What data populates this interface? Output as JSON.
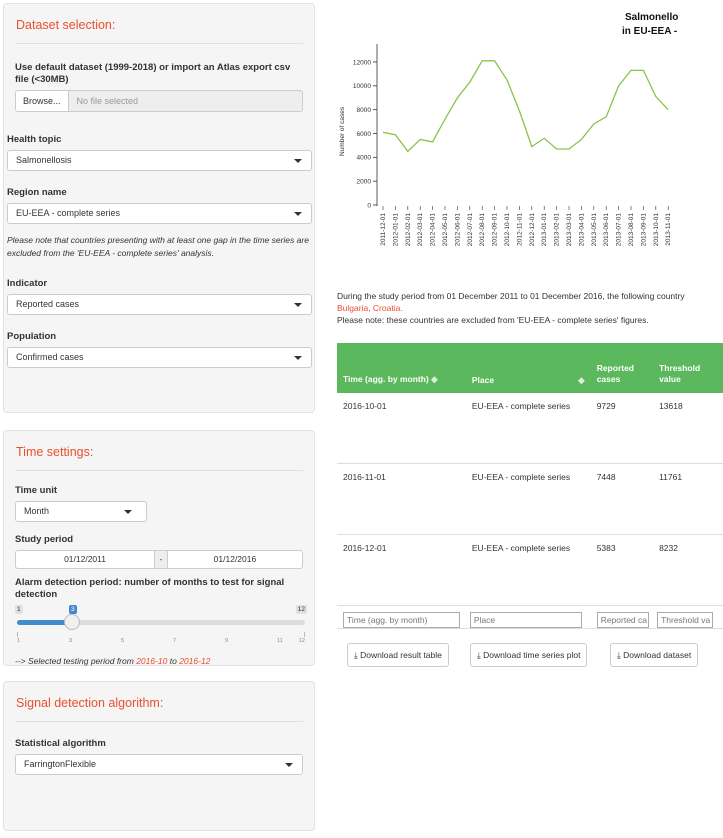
{
  "dataset_panel": {
    "title": "Dataset selection:",
    "import_label": "Use default dataset (1999-2018) or import an Atlas export csv file (<30MB)",
    "browse_label": "Browse...",
    "file_placeholder": "No file selected",
    "health_topic_label": "Health topic",
    "health_topic_value": "Salmonellosis",
    "region_label": "Region name",
    "region_value": "EU-EEA - complete series",
    "region_note": "Please note that countries presenting with at least one gap in the time series are excluded from the 'EU-EEA - complete series' analysis.",
    "indicator_label": "Indicator",
    "indicator_value": "Reported cases",
    "population_label": "Population",
    "population_value": "Confirmed cases"
  },
  "time_panel": {
    "title": "Time settings:",
    "time_unit_label": "Time unit",
    "time_unit_value": "Month",
    "study_period_label": "Study period",
    "start_date": "01/12/2011",
    "date_sep": "-",
    "end_date": "01/12/2016",
    "alarm_label": "Alarm detection period: number of months to test for signal detection",
    "slider_min": "1",
    "slider_max": "12",
    "slider_value": "3",
    "slider_ticks": [
      "1",
      "3",
      "5",
      "7",
      "9",
      "11",
      "12"
    ],
    "testing_prefix": "--> Selected testing period from ",
    "testing_from": "2016-10",
    "testing_mid": " to ",
    "testing_to": "2016-12"
  },
  "algo_panel": {
    "title": "Signal detection algorithm:",
    "algo_label": "Statistical algorithm",
    "algo_value": "FarringtonFlexible"
  },
  "plot": {
    "title_line1": "Salmonello",
    "title_line2": "in EU-EEA - ",
    "ylabel": "Number of cases"
  },
  "chart_data": {
    "type": "line",
    "title": "Salmonello in EU-EEA -",
    "ylabel": "Number of cases",
    "ylim": [
      0,
      12000
    ],
    "yticks": [
      "0",
      "2000",
      "4000",
      "6000",
      "8000",
      "10000",
      "12000"
    ],
    "x": [
      "2011-12-01",
      "2012-01-01",
      "2012-02-01",
      "2012-03-01",
      "2012-04-01",
      "2012-05-01",
      "2012-06-01",
      "2012-07-01",
      "2012-08-01",
      "2012-09-01",
      "2012-10-01",
      "2012-11-01",
      "2012-12-01",
      "2013-01-01",
      "2013-02-01",
      "2013-03-01",
      "2013-04-01",
      "2013-05-01",
      "2013-06-01",
      "2013-07-01",
      "2013-08-01",
      "2013-09-01",
      "2013-10-01",
      "2013-11-01"
    ],
    "series": [
      {
        "color": "#8bc34a",
        "values": [
          6100,
          5900,
          4500,
          5500,
          5300,
          7200,
          9000,
          10300,
          12100,
          12100,
          10500,
          7900,
          4900,
          5600,
          4700,
          4700,
          5500,
          6800,
          7400,
          10000,
          11300,
          11300,
          9100,
          8000
        ]
      }
    ]
  },
  "study_text": {
    "line1": "During the study period from 01 December 2011 to 01 December 2016, the following country",
    "countries": "Bulgaria, Croatia.",
    "line3": "Please note: these countries are excluded from 'EU-EEA - complete series' figures."
  },
  "table": {
    "headers": [
      "Time (agg. by month)",
      "Place",
      "Reported cases",
      "Threshold value"
    ],
    "rows": [
      [
        "2016-10-01",
        "EU-EEA - complete series",
        "9729",
        "13618"
      ],
      [
        "2016-11-01",
        "EU-EEA - complete series",
        "7448",
        "11761"
      ],
      [
        "2016-12-01",
        "EU-EEA - complete series",
        "5383",
        "8232"
      ]
    ],
    "filters": [
      "Time (agg. by month)",
      "Place",
      "Reported ca",
      "Threshold va"
    ]
  },
  "downloads": {
    "result_table": "Download result table",
    "time_series_plot": "Download time series plot",
    "dataset": "Download dataset"
  }
}
